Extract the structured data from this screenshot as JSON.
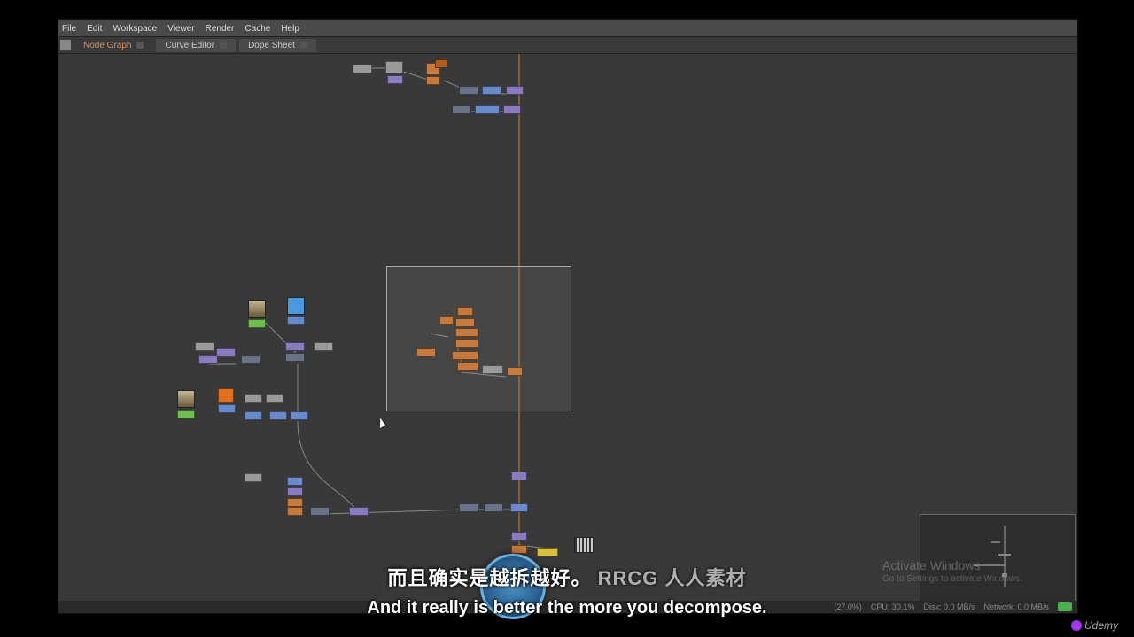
{
  "menubar": {
    "file": "File",
    "edit": "Edit",
    "workspace": "Workspace",
    "viewer": "Viewer",
    "render": "Render",
    "cache": "Cache",
    "help": "Help"
  },
  "tabs": {
    "node_graph": "Node Graph",
    "curve_editor": "Curve Editor",
    "dope_sheet": "Dope Sheet"
  },
  "status": {
    "ram_pct": "(27.0%)",
    "cpu": "CPU: 30.1%",
    "disk": "Disk: 0.0 MB/s",
    "network": "Network: 0.0 MB/s"
  },
  "watermark": {
    "activate_title": "Activate Windows",
    "activate_sub": "Go to Settings to activate Windows."
  },
  "subtitles": {
    "cn": "而且确实是越拆越好。",
    "wm_text": "RRCG 人人素材",
    "en": "And it really is better the more you decompose."
  },
  "branding": {
    "udemy": "Udemy"
  },
  "colors": {
    "orange": "#c77a3e",
    "purple": "#8a7abf",
    "blue": "#6a8acc",
    "slate": "#6a7288",
    "green": "#6fbf4f",
    "brightblue": "#4a9adf",
    "grey": "#9a9a9a",
    "darkorange": "#b05f1f"
  }
}
